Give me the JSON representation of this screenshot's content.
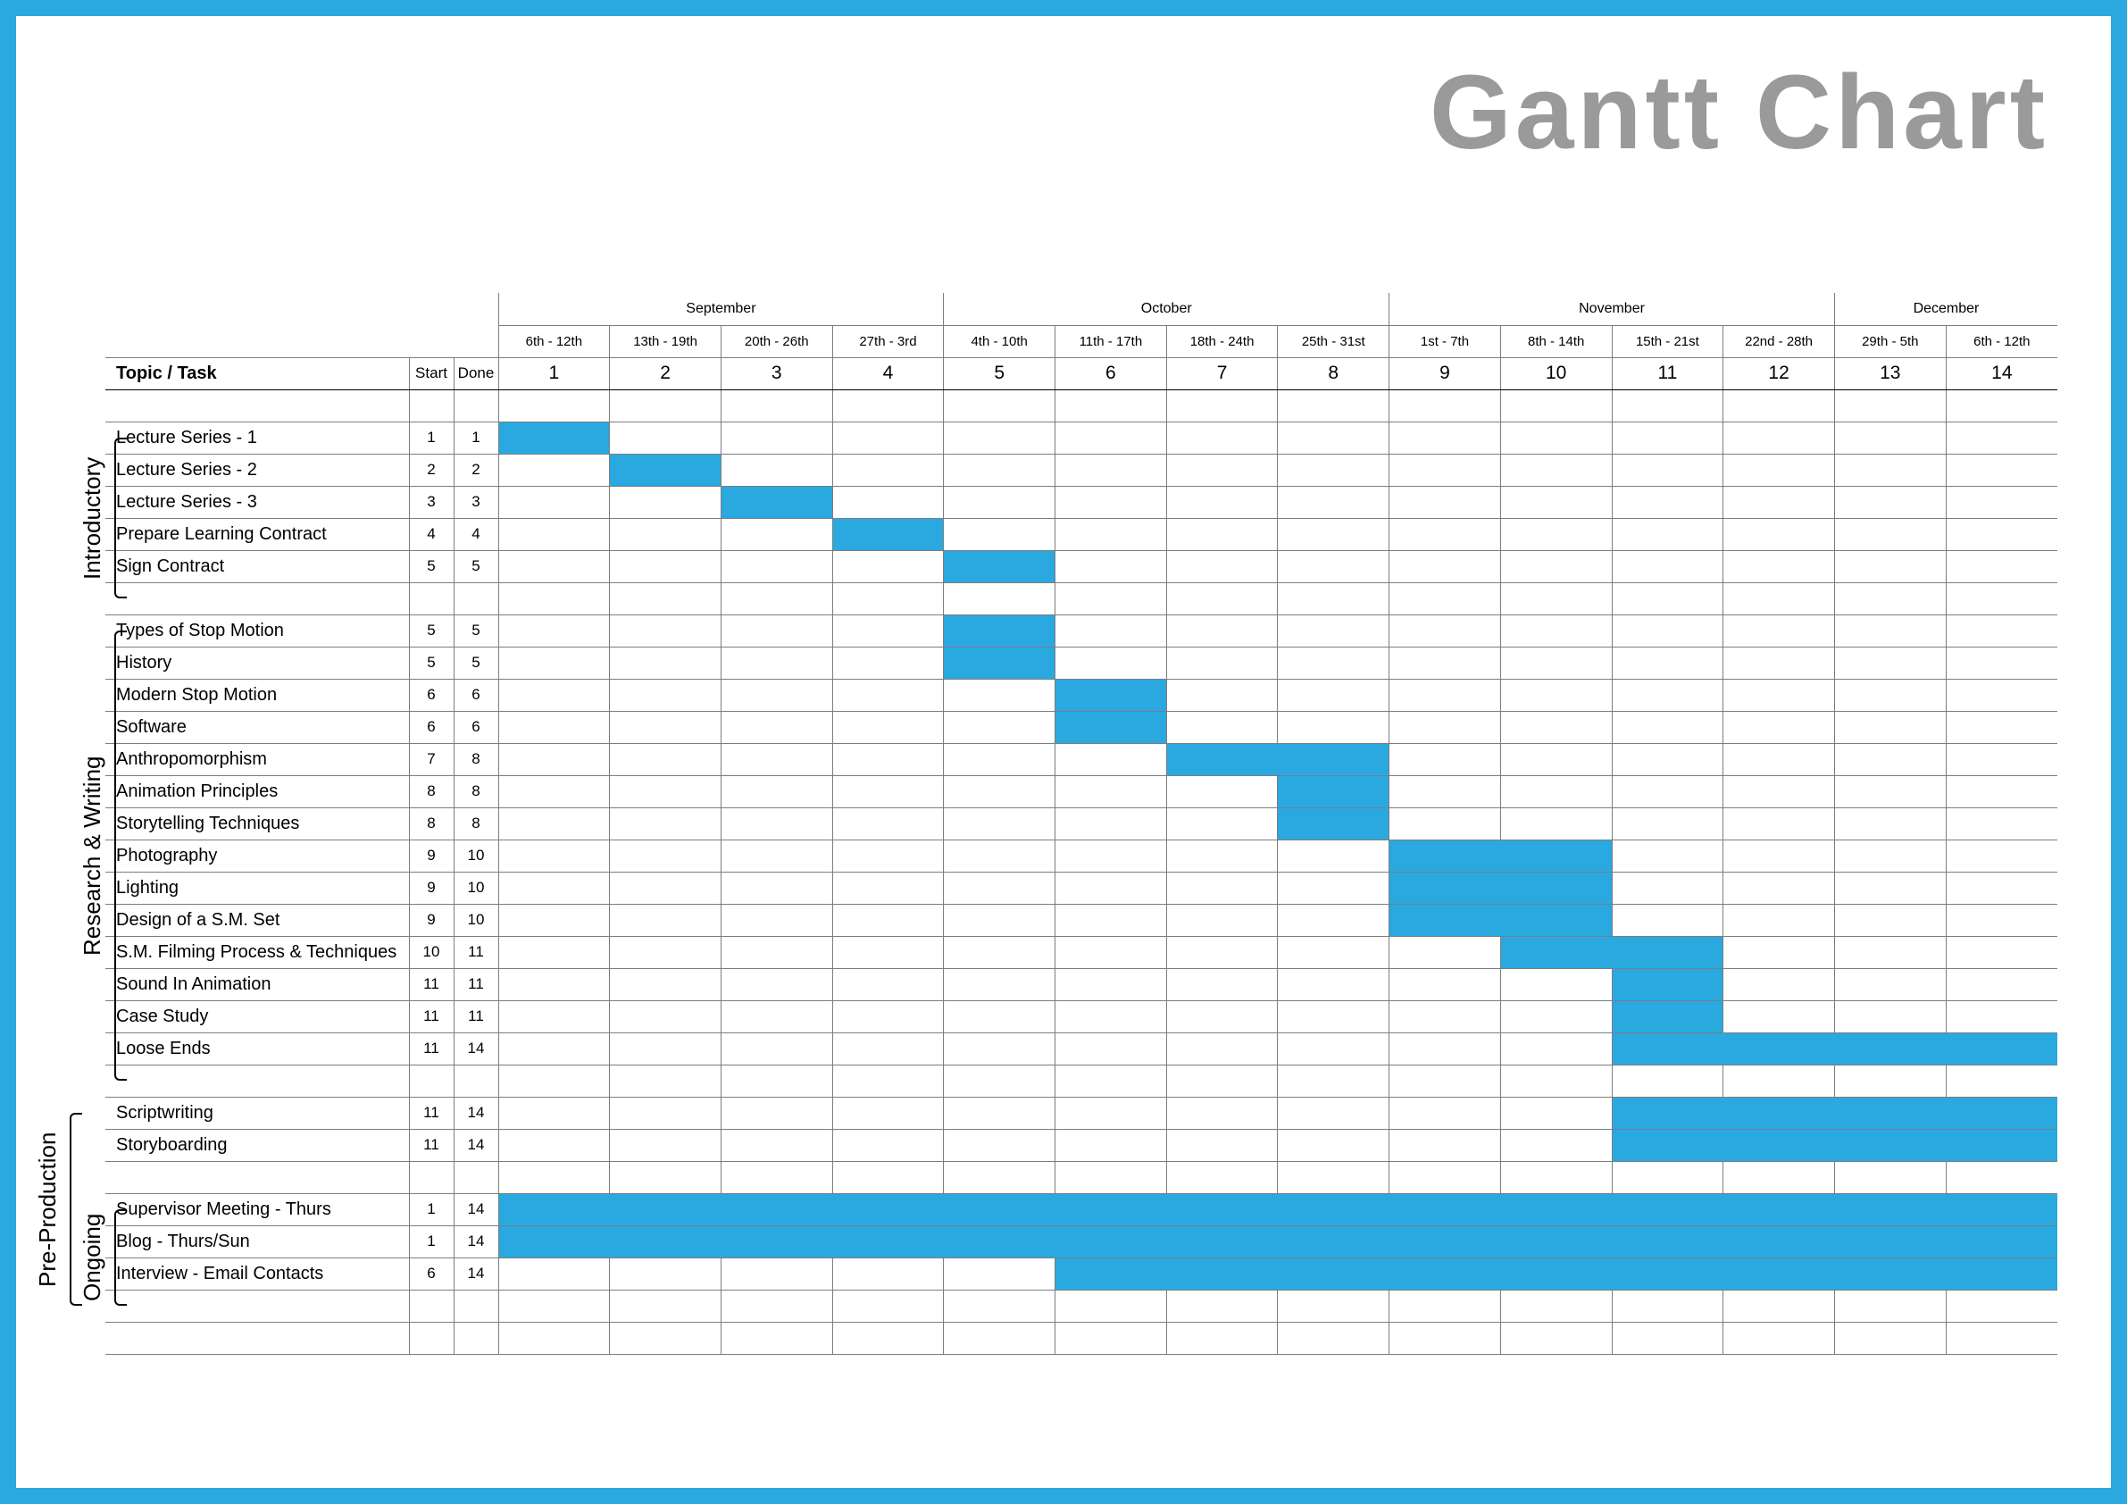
{
  "title": "Gantt Chart",
  "months": [
    "September",
    "October",
    "November",
    "December"
  ],
  "weeks": [
    {
      "n": 1,
      "range": "6th - 12th"
    },
    {
      "n": 2,
      "range": "13th - 19th"
    },
    {
      "n": 3,
      "range": "20th - 26th"
    },
    {
      "n": 4,
      "range": "27th - 3rd"
    },
    {
      "n": 5,
      "range": "4th - 10th"
    },
    {
      "n": 6,
      "range": "11th - 17th"
    },
    {
      "n": 7,
      "range": "18th - 24th"
    },
    {
      "n": 8,
      "range": "25th - 31st"
    },
    {
      "n": 9,
      "range": "1st - 7th"
    },
    {
      "n": 10,
      "range": "8th - 14th"
    },
    {
      "n": 11,
      "range": "15th - 21st"
    },
    {
      "n": 12,
      "range": "22nd - 28th"
    },
    {
      "n": 13,
      "range": "29th - 5th"
    },
    {
      "n": 14,
      "range": "6th - 12th"
    }
  ],
  "headers": {
    "topic": "Topic / Task",
    "start": "Start",
    "done": "Done"
  },
  "sections": [
    {
      "name": "Introductory",
      "rowspan": [
        1,
        6
      ]
    },
    {
      "name": "Research & Writing",
      "rowspan": [
        8,
        21
      ]
    },
    {
      "name": "Pre-Production",
      "rowspan": [
        23,
        24
      ]
    },
    {
      "name": "Ongoing",
      "rowspan": [
        26,
        28
      ]
    }
  ],
  "rows": [
    {
      "spacer": true
    },
    {
      "task": "Lecture Series - 1",
      "start": 1,
      "done": 1,
      "bar": [
        1,
        1
      ]
    },
    {
      "task": "Lecture Series - 2",
      "start": 2,
      "done": 2,
      "bar": [
        2,
        2
      ]
    },
    {
      "task": "Lecture Series - 3",
      "start": 3,
      "done": 3,
      "bar": [
        3,
        3
      ]
    },
    {
      "task": "Prepare Learning Contract",
      "start": 4,
      "done": 4,
      "bar": [
        4,
        4
      ]
    },
    {
      "task": "Sign Contract",
      "start": 5,
      "done": 5,
      "bar": [
        5,
        5
      ]
    },
    {
      "spacer": true
    },
    {
      "task": "Types of Stop Motion",
      "start": 5,
      "done": 5,
      "bar": [
        5,
        5
      ]
    },
    {
      "task": "History",
      "start": 5,
      "done": 5,
      "bar": [
        5,
        5
      ]
    },
    {
      "task": "Modern Stop Motion",
      "start": 6,
      "done": 6,
      "bar": [
        6,
        6
      ]
    },
    {
      "task": "Software",
      "start": 6,
      "done": 6,
      "bar": [
        6,
        6
      ]
    },
    {
      "task": "Anthropomorphism",
      "start": 7,
      "done": 8,
      "bar": [
        7,
        8
      ]
    },
    {
      "task": "Animation Principles",
      "start": 8,
      "done": 8,
      "bar": [
        8,
        8
      ]
    },
    {
      "task": "Storytelling Techniques",
      "start": 8,
      "done": 8,
      "bar": [
        8,
        8
      ]
    },
    {
      "task": "Photography",
      "start": 9,
      "done": 10,
      "bar": [
        9,
        10
      ]
    },
    {
      "task": "Lighting",
      "start": 9,
      "done": 10,
      "bar": [
        9,
        10
      ]
    },
    {
      "task": "Design of a S.M. Set",
      "start": 9,
      "done": 10,
      "bar": [
        9,
        10
      ]
    },
    {
      "task": "S.M. Filming Process & Techniques",
      "start": 10,
      "done": 11,
      "bar": [
        10,
        11
      ]
    },
    {
      "task": "Sound In Animation",
      "start": 11,
      "done": 11,
      "bar": [
        11,
        11
      ]
    },
    {
      "task": "Case Study",
      "start": 11,
      "done": 11,
      "bar": [
        11,
        11
      ]
    },
    {
      "task": "Loose Ends",
      "start": 11,
      "done": 14,
      "bar": [
        11,
        14
      ]
    },
    {
      "spacer": true
    },
    {
      "task": "Scriptwriting",
      "start": 11,
      "done": 14,
      "bar": [
        11,
        14
      ]
    },
    {
      "task": "Storyboarding",
      "start": 11,
      "done": 14,
      "bar": [
        11,
        14
      ]
    },
    {
      "spacer": true
    },
    {
      "task": "Supervisor Meeting - Thurs",
      "start": 1,
      "done": 14,
      "bar": [
        1,
        14
      ]
    },
    {
      "task": "Blog - Thurs/Sun",
      "start": 1,
      "done": 14,
      "bar": [
        1,
        14
      ]
    },
    {
      "task": "Interview - Email Contacts",
      "start": 6,
      "done": 14,
      "bar": [
        6,
        14
      ]
    },
    {
      "spacer": true
    },
    {
      "spacer": true
    }
  ],
  "chart_data": {
    "type": "gantt",
    "x_unit": "week",
    "x_range": [
      1,
      14
    ],
    "x_labels": [
      "6th - 12th Sep",
      "13th - 19th Sep",
      "20th - 26th Sep",
      "27th Sep - 3rd Oct",
      "4th - 10th Oct",
      "11th - 17th Oct",
      "18th - 24th Oct",
      "25th - 31st Oct",
      "1st - 7th Nov",
      "8th - 14th Nov",
      "15th - 21st Nov",
      "22nd - 28th Nov",
      "29th Nov - 5th Dec",
      "6th - 12th Dec"
    ],
    "groups": [
      {
        "name": "Introductory",
        "tasks": [
          {
            "name": "Lecture Series - 1",
            "start": 1,
            "end": 1
          },
          {
            "name": "Lecture Series - 2",
            "start": 2,
            "end": 2
          },
          {
            "name": "Lecture Series - 3",
            "start": 3,
            "end": 3
          },
          {
            "name": "Prepare Learning Contract",
            "start": 4,
            "end": 4
          },
          {
            "name": "Sign Contract",
            "start": 5,
            "end": 5
          }
        ]
      },
      {
        "name": "Research & Writing",
        "tasks": [
          {
            "name": "Types of Stop Motion",
            "start": 5,
            "end": 5
          },
          {
            "name": "History",
            "start": 5,
            "end": 5
          },
          {
            "name": "Modern Stop Motion",
            "start": 6,
            "end": 6
          },
          {
            "name": "Software",
            "start": 6,
            "end": 6
          },
          {
            "name": "Anthropomorphism",
            "start": 7,
            "end": 8
          },
          {
            "name": "Animation Principles",
            "start": 8,
            "end": 8
          },
          {
            "name": "Storytelling Techniques",
            "start": 8,
            "end": 8
          },
          {
            "name": "Photography",
            "start": 9,
            "end": 10
          },
          {
            "name": "Lighting",
            "start": 9,
            "end": 10
          },
          {
            "name": "Design of a S.M. Set",
            "start": 9,
            "end": 10
          },
          {
            "name": "S.M. Filming Process & Techniques",
            "start": 10,
            "end": 11
          },
          {
            "name": "Sound In Animation",
            "start": 11,
            "end": 11
          },
          {
            "name": "Case Study",
            "start": 11,
            "end": 11
          },
          {
            "name": "Loose Ends",
            "start": 11,
            "end": 14
          }
        ]
      },
      {
        "name": "Pre-Production",
        "tasks": [
          {
            "name": "Scriptwriting",
            "start": 11,
            "end": 14
          },
          {
            "name": "Storyboarding",
            "start": 11,
            "end": 14
          }
        ]
      },
      {
        "name": "Ongoing",
        "tasks": [
          {
            "name": "Supervisor Meeting - Thurs",
            "start": 1,
            "end": 14
          },
          {
            "name": "Blog - Thurs/Sun",
            "start": 1,
            "end": 14
          },
          {
            "name": "Interview - Email Contacts",
            "start": 6,
            "end": 14
          }
        ]
      }
    ]
  }
}
